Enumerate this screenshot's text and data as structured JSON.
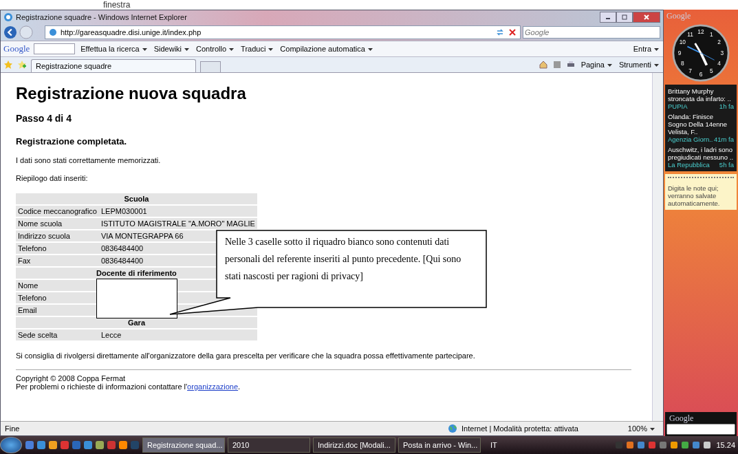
{
  "slide_caption": "finestra",
  "window": {
    "title": "Registrazione squadre - Windows Internet Explorer"
  },
  "address_bar": {
    "url": "http://gareasquadre.disi.unige.it/index.php",
    "search_placeholder": "Google"
  },
  "google_toolbar": {
    "logo": "Google",
    "items": [
      {
        "label": "Effettua la ricerca"
      },
      {
        "label": "Sidewiki"
      },
      {
        "label": "Controllo"
      },
      {
        "label": "Traduci"
      },
      {
        "label": "Compilazione automatica"
      },
      {
        "label": "Entra"
      }
    ]
  },
  "tabs": [
    {
      "label": "Registrazione squadre",
      "selected": true
    }
  ],
  "command_bar": [
    {
      "label": "Pagina"
    },
    {
      "label": "Strumenti"
    }
  ],
  "page": {
    "heading": "Registrazione nuova squadra",
    "step": "Passo 4 di 4",
    "status": "Registrazione completata.",
    "message": "I dati sono stati correttamente memorizzati.",
    "summary_label": "Riepilogo dati inseriti:",
    "table": [
      {
        "title": "Scuola",
        "rows": [
          {
            "label": "Codice meccanografico",
            "value": "LEPM030001"
          },
          {
            "label": "Nome scuola",
            "value": "ISTITUTO MAGISTRALE \"A.MORO\" MAGLIE"
          },
          {
            "label": "Indirizzo scuola",
            "value": "VIA MONTEGRAPPA 66"
          },
          {
            "label": "Telefono",
            "value": "0836484400"
          },
          {
            "label": "Fax",
            "value": "0836484400"
          }
        ]
      },
      {
        "title": "Docente di riferimento",
        "rows": [
          {
            "label": "Nome"
          },
          {
            "label": "Telefono"
          },
          {
            "label": "Email"
          }
        ]
      },
      {
        "title": "Gara",
        "rows": [
          {
            "label": "Sede scelta",
            "value": "Lecce"
          }
        ]
      }
    ],
    "advice": "Si consiglia di rivolgersi direttamente all'organizzatore della gara prescelta per verificare che la squadra possa effettivamente partecipare.",
    "footer": {
      "copyright": "Copyright © 2008 Coppa Fermat",
      "contact_text": "Per problemi o richieste di informazioni contattare l'",
      "contact_link": "organizzazione",
      "contact_end": "."
    }
  },
  "callout": {
    "text": "Nelle 3 caselle sotto il riquadro bianco sono contenuti dati personali del referente inseriti al punto precedente. [Qui sono stati nascosti per ragioni di privacy]"
  },
  "status_bar": {
    "status": "Fine",
    "zone": "Internet | Modalità protetta: attivata",
    "zoom": "100%"
  },
  "sidebar": {
    "logo": "Google",
    "clock_numerals": [
      "12",
      "1",
      "2",
      "3",
      "4",
      "5",
      "6",
      "7",
      "8",
      "9",
      "10",
      "11"
    ],
    "news": [
      {
        "title": "Brittany Murphy stroncata da infarto: ..",
        "source": "PUPIA",
        "age": "1h fa"
      },
      {
        "title": "Olanda: Finisce Sogno Della 14enne Velista, F..",
        "source": "Agenzia Giorn..",
        "age": "41m fa"
      },
      {
        "title": "Auschwitz, i ladri sono pregiudicati nessuno ..",
        "source": "La Repubblica",
        "age": "5h fa"
      }
    ],
    "notes": "Digita le note qui; verranno salvate automaticamente.",
    "search_logo": "Google"
  },
  "taskbar": {
    "tasks": [
      {
        "label": "Registrazione squad...",
        "selected": true
      },
      {
        "label": "2010",
        "selected": false
      },
      {
        "label": "Indirizzi.doc [Modali...",
        "selected": false
      },
      {
        "label": "Posta in arrivo - Win...",
        "selected": false
      }
    ],
    "language": "IT",
    "clock": "15.24"
  }
}
